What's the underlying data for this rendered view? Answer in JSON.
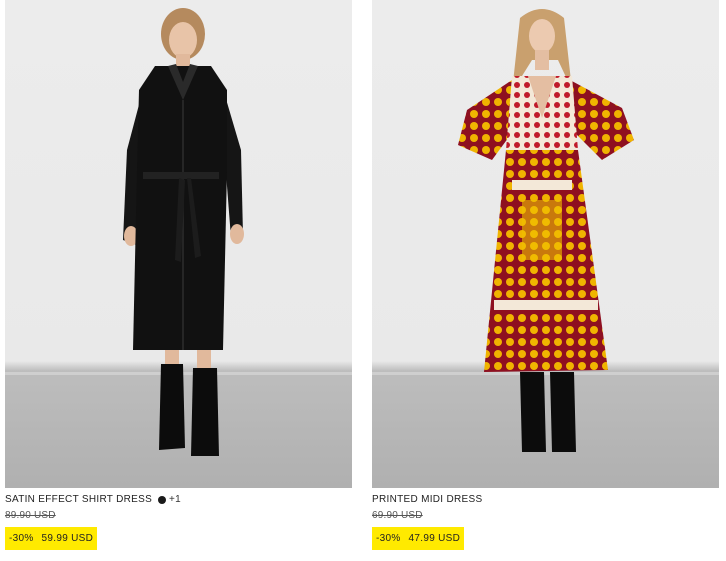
{
  "products": [
    {
      "name": "SATIN EFFECT SHIRT DRESS",
      "extra_colors": "+1",
      "swatch_color": "#1a1a1a",
      "original_price": "89.90 USD",
      "discount": "-30%",
      "sale_price": "59.99 USD",
      "image_icon": "model-black-satin-dress-image"
    },
    {
      "name": "PRINTED MIDI DRESS",
      "original_price": "69.90 USD",
      "discount": "-30%",
      "sale_price": "47.99 USD",
      "image_icon": "model-printed-midi-dress-image"
    }
  ],
  "colors": {
    "sale_badge": "#ffea00",
    "background": "#ffffff",
    "photo_wall": "#ececec",
    "photo_floor": "#b5b5b5"
  }
}
